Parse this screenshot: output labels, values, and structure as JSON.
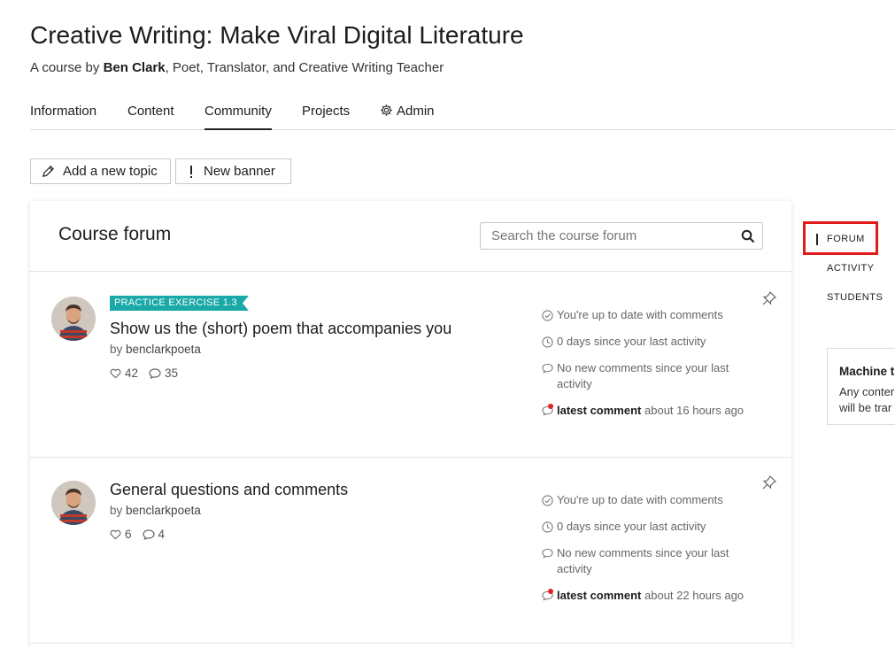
{
  "course": {
    "title": "Creative Writing: Make Viral Digital Literature",
    "byline_prefix": "A course by",
    "author": "Ben Clark",
    "author_roles": ", Poet, Translator, and Creative Writing Teacher"
  },
  "tabs": [
    {
      "label": "Information",
      "active": false
    },
    {
      "label": "Content",
      "active": false
    },
    {
      "label": "Community",
      "active": true
    },
    {
      "label": "Projects",
      "active": false
    },
    {
      "label": "Admin",
      "active": false,
      "icon": "gear-icon"
    }
  ],
  "toolbar": {
    "add_topic_label": "Add a new topic",
    "add_topic_icon": "pencil-icon",
    "new_banner_label": "New banner",
    "new_banner_icon": "exclamation-icon"
  },
  "forum": {
    "title": "Course forum",
    "search_placeholder": "Search the course forum",
    "topics": [
      {
        "badge": "PRACTICE EXERCISE 1.3",
        "title": "Show us the (short) poem that accompanies you",
        "by": "by",
        "author": "benclarkpoeta",
        "likes": "42",
        "comments": "35",
        "status_uptodate": "You're up to date with comments",
        "status_days": "0 days since your last activity",
        "status_nonew": "No new comments since your last activity",
        "latest_label": "latest comment",
        "latest_time": "about 16 hours ago"
      },
      {
        "badge": "",
        "title": "General questions and comments",
        "by": "by",
        "author": "benclarkpoeta",
        "likes": "6",
        "comments": "4",
        "status_uptodate": "You're up to date with comments",
        "status_days": "0 days since your last activity",
        "status_nonew": "No new comments since your last activity",
        "latest_label": "latest comment",
        "latest_time": "about 22 hours ago"
      }
    ]
  },
  "right_nav": {
    "items": [
      "FORUM",
      "ACTIVITY",
      "STUDENTS"
    ],
    "active": "FORUM"
  },
  "machine_translation": {
    "title": "Machine t",
    "body_line1": "Any conter",
    "body_line2": "will be trar"
  },
  "colors": {
    "badge_teal": "#1aa8a8",
    "highlight_red": "#e31b1b",
    "notification_dot": "#e52222"
  }
}
